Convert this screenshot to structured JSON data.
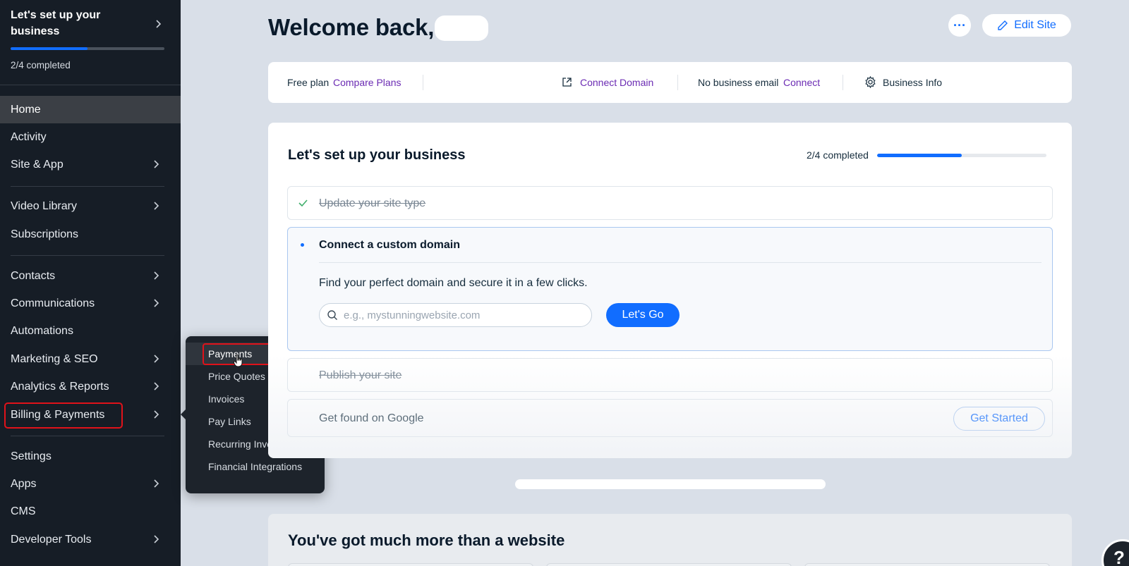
{
  "sidebar": {
    "setup": {
      "title": "Let's set up your business",
      "count": "2/4 completed",
      "progress": 0.5
    },
    "items": [
      {
        "label": "Home"
      },
      {
        "label": "Activity"
      },
      {
        "label": "Site & App"
      },
      {
        "label": "Video Library"
      },
      {
        "label": "Subscriptions"
      },
      {
        "label": "Contacts"
      },
      {
        "label": "Communications"
      },
      {
        "label": "Automations"
      },
      {
        "label": "Marketing & SEO"
      },
      {
        "label": "Analytics & Reports"
      },
      {
        "label": "Billing & Payments"
      },
      {
        "label": "Settings"
      },
      {
        "label": "Apps"
      },
      {
        "label": "CMS"
      },
      {
        "label": "Developer Tools"
      }
    ]
  },
  "flyout": {
    "items": [
      {
        "label": "Payments"
      },
      {
        "label": "Price Quotes"
      },
      {
        "label": "Invoices"
      },
      {
        "label": "Pay Links"
      },
      {
        "label": "Recurring Invoices"
      },
      {
        "label": "Financial Integrations"
      }
    ]
  },
  "header": {
    "welcome": "Welcome back,",
    "more_label": "···",
    "edit_site_label": "Edit Site"
  },
  "info_bar": {
    "plan": "Free plan",
    "compare_plans": "Compare Plans",
    "connect_domain": "Connect Domain",
    "no_email": "No business email",
    "connect": "Connect",
    "business_info": "Business Info"
  },
  "setup_card": {
    "title": "Let's set up your business",
    "count": "2/4 completed",
    "progress": 0.5,
    "steps": {
      "site_type": "Update your site type",
      "custom_domain": {
        "title": "Connect a custom domain",
        "description": "Find your perfect domain and secure it in a few clicks.",
        "placeholder": "e.g., mystunningwebsite.com",
        "button": "Let's Go"
      },
      "publish": "Publish your site",
      "google": {
        "label": "Get found on Google",
        "button": "Get Started"
      }
    }
  },
  "more_section": {
    "title": "You've got much more than a website"
  },
  "help": {
    "label": "?"
  },
  "colors": {
    "accent": "#116dff",
    "sidebar_bg": "#161d26",
    "link_purple": "#6b2bb3",
    "highlight_red": "#e0121a"
  }
}
